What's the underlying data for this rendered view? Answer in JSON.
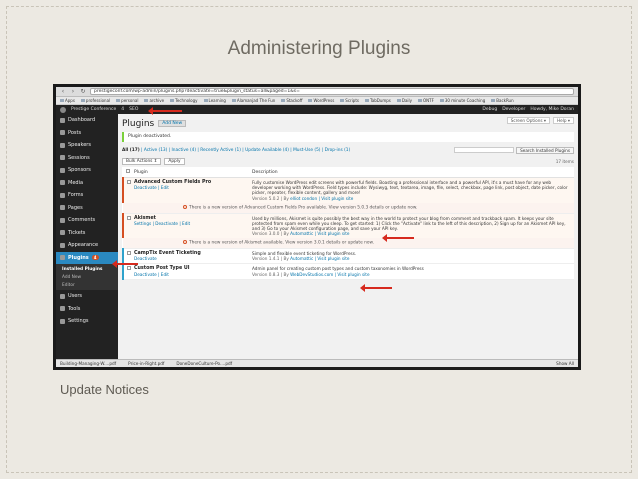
{
  "slide": {
    "title": "Administering Plugins",
    "caption": "Update Notices"
  },
  "browser": {
    "url": "prestigeconf.com/wp-admin/plugins.php?deactivate=true&plugin_status=all&paged=1&s=",
    "bookmarks": [
      "Apps",
      "professional",
      "personal",
      "archive",
      "Technology",
      "Learning",
      "Alamanjad The Fun",
      "Stackoff",
      "WordPress",
      "Scripts",
      "TabDumps",
      "Daily",
      "ONTF",
      "30 minute Coaching",
      "BackRun"
    ]
  },
  "adminbar": {
    "site": "Prestige Conference",
    "count": "4",
    "seo": "SEO",
    "right": [
      "Debug",
      "Developer",
      "Howdy, Mike Doran"
    ]
  },
  "sidebar": {
    "items": [
      {
        "label": "Dashboard"
      },
      {
        "label": "Posts"
      },
      {
        "label": "Speakers"
      },
      {
        "label": "Sessions"
      },
      {
        "label": "Sponsors"
      },
      {
        "label": "Media"
      },
      {
        "label": "Forms"
      },
      {
        "label": "Pages"
      },
      {
        "label": "Comments"
      },
      {
        "label": "Tickets"
      }
    ],
    "appearance": "Appearance",
    "plugins": "Plugins",
    "plugins_badge": "4",
    "submenu": [
      "Installed Plugins",
      "Add New",
      "Editor"
    ],
    "after": [
      {
        "label": "Users"
      },
      {
        "label": "Tools"
      },
      {
        "label": "Settings"
      }
    ]
  },
  "main": {
    "title": "Plugins",
    "add_new": "Add New",
    "screen_options": "Screen Options ▾",
    "help": "Help ▾",
    "notice": "Plugin deactivated.",
    "filters_all": "All (17)",
    "filters_rest": " | Active (13) | Inactive (4) | Recently Active (1) | Update Available (4) | Must-Use (5) | Drop-ins (1)",
    "search_button": "Search Installed Plugins",
    "bulk_actions": "Bulk Actions ⇕",
    "apply": "Apply",
    "item_count": "17 items",
    "col_plugin": "Plugin",
    "col_description": "Description"
  },
  "plugins": [
    {
      "name": "Advanced Custom Fields Pro",
      "actions": "Deactivate | Edit",
      "description": "Fully customise WordPress edit screens with powerful fields. Boasting a professional interface and a powerful API, it's a must have for any web developer working with WordPress. Field types include: Wysiwyg, text, textarea, image, file, select, checkbox, page link, post object, date picker, color picker, repeater, flexible content, gallery and more!",
      "meta_version": "Version 5.0.2 | By ",
      "meta_author": "elliot condon",
      "meta_site": " | Visit plugin site",
      "update": "There is a new version of Advanced Custom Fields Pro available. View version 5.0.3 details or update now."
    },
    {
      "name": "Akismet",
      "actions": "Settings | Deactivate | Edit",
      "description": "Used by millions, Akismet is quite possibly the best way in the world to protect your blog from comment and trackback spam. It keeps your site protected from spam even while you sleep. To get started: 1) Click the \"Activate\" link to the left of this description, 2) Sign up for an Akismet API key, and 3) Go to your Akismet configuration page, and save your API key.",
      "meta_version": "Version 3.0.0 | By ",
      "meta_author": "Automattic",
      "meta_site": " | Visit plugin site",
      "update": "There is a new version of Akismet available. View version 3.0.1 details or update now."
    },
    {
      "name": "CampTix Event Ticketing",
      "actions": "Deactivate",
      "description": "Simple and flexible event ticketing for WordPress.",
      "meta_version": "Version 1.4.1 | By ",
      "meta_author": "Automattic",
      "meta_site": " | Visit plugin site"
    },
    {
      "name": "Custom Post Type UI",
      "actions": "Deactivate | Edit",
      "description": "Admin panel for creating custom post types and custom taxonomies in WordPress",
      "meta_version": "Version 0.8.3 | By ",
      "meta_author": "WebDevStudios.com",
      "meta_site": " | Visit plugin site"
    }
  ],
  "taskbar": {
    "files": [
      "Building-Managing-W....pdf",
      "Price-in-Right.pdf",
      "DoneDoneCulture-Po....pdf"
    ],
    "show_all": "Show All"
  },
  "colors": {
    "active_blue": "#2a89c1",
    "inactive_orange": "#d54e21",
    "annotation_red": "#d62a1e"
  }
}
